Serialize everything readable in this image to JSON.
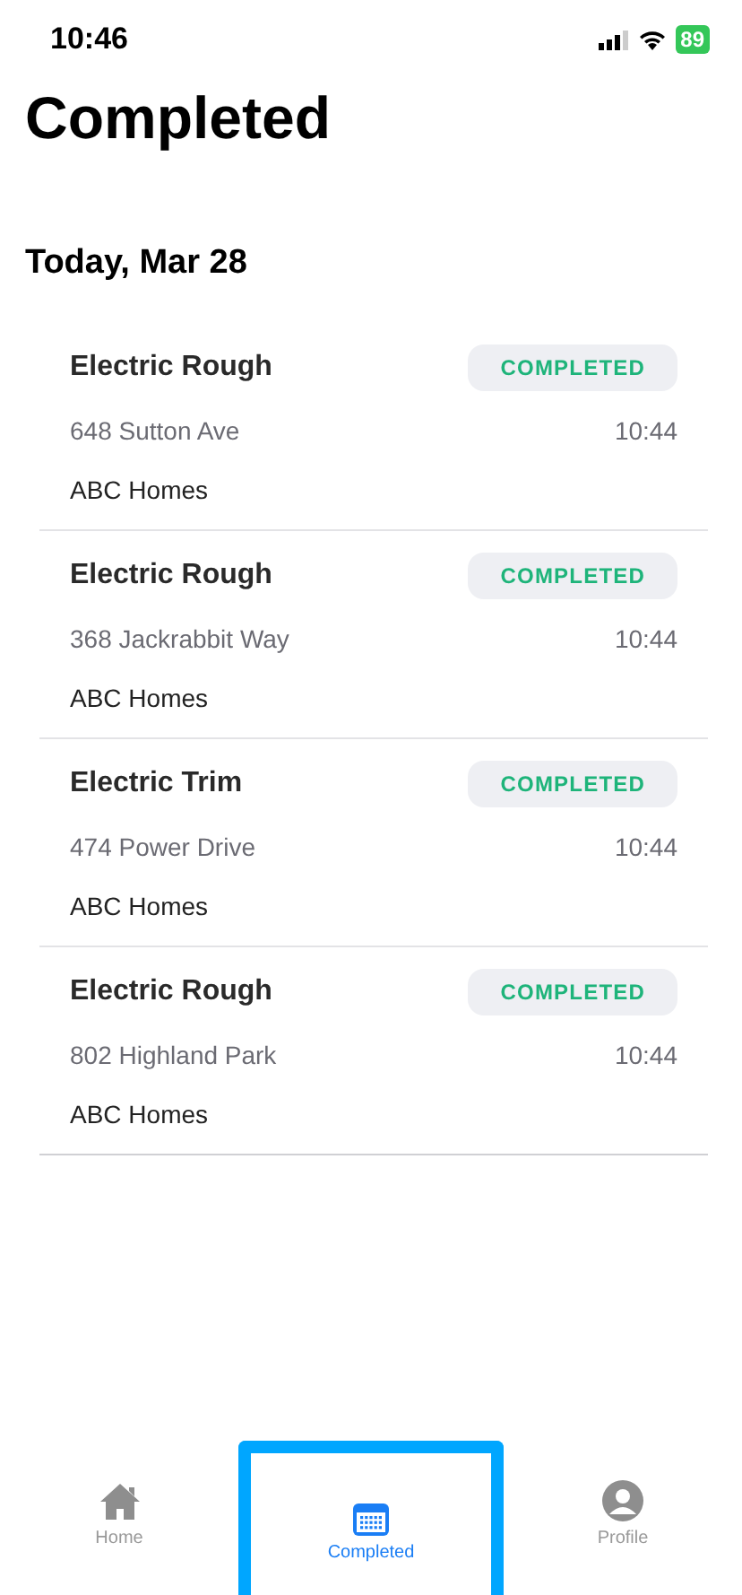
{
  "status_bar": {
    "time": "10:46",
    "battery": "89"
  },
  "title": "Completed",
  "section": {
    "title": "Today, Mar 28"
  },
  "jobs": [
    {
      "name": "Electric Rough",
      "status": "COMPLETED",
      "address": "648 Sutton Ave",
      "time": "10:44",
      "builder": "ABC Homes"
    },
    {
      "name": "Electric Rough",
      "status": "COMPLETED",
      "address": "368 Jackrabbit Way",
      "time": "10:44",
      "builder": "ABC Homes"
    },
    {
      "name": "Electric Trim",
      "status": "COMPLETED",
      "address": "474 Power Drive",
      "time": "10:44",
      "builder": "ABC Homes"
    },
    {
      "name": "Electric Rough",
      "status": "COMPLETED",
      "address": "802 Highland Park",
      "time": "10:44",
      "builder": "ABC Homes"
    }
  ],
  "tabs": [
    {
      "kind": "home",
      "label": "Home",
      "selected": false
    },
    {
      "kind": "calendar",
      "label": "Completed",
      "selected": true
    },
    {
      "kind": "profile",
      "label": "Profile",
      "selected": false
    }
  ]
}
